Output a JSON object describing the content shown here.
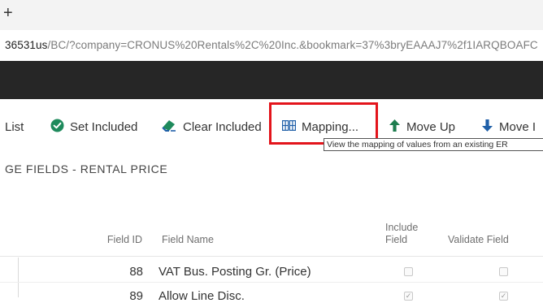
{
  "browser": {
    "tab_glyph": "+",
    "address_host_part": "36531us",
    "address_rest": "/BC/?company=CRONUS%20Rentals%2C%20Inc.&bookmark=37%3bryEAAAJ7%2f1IARQBOAFC"
  },
  "actions": [
    {
      "label": "List",
      "icon": "none"
    },
    {
      "label": "Set Included",
      "icon": "check-circle-icon"
    },
    {
      "label": "Clear Included",
      "icon": "eraser-icon"
    },
    {
      "label": "Mapping...",
      "icon": "mapping-table-icon"
    },
    {
      "label": "Move Up",
      "icon": "arrow-up-icon"
    },
    {
      "label": "Move I",
      "icon": "arrow-down-icon"
    }
  ],
  "tooltip": "View the mapping of values from an existing ER",
  "page_title": "GE FIELDS - RENTAL PRICE",
  "columns": {
    "field_id": "Field ID",
    "field_name": "Field Name",
    "include_field_1": "Include",
    "include_field_2": "Field",
    "validate_field": "Validate Field"
  },
  "rows": [
    {
      "field_id": "88",
      "field_name": "VAT Bus. Posting Gr. (Price)",
      "include": false,
      "validate": false
    },
    {
      "field_id": "89",
      "field_name": "Allow Line Disc.",
      "include": true,
      "validate": true
    }
  ],
  "colors": {
    "highlight": "#e3141b",
    "check_green": "#1e8a5c",
    "arrow_green": "#1e7d4f",
    "arrow_blue": "#1f5fa8",
    "dark_bar": "#262626"
  }
}
